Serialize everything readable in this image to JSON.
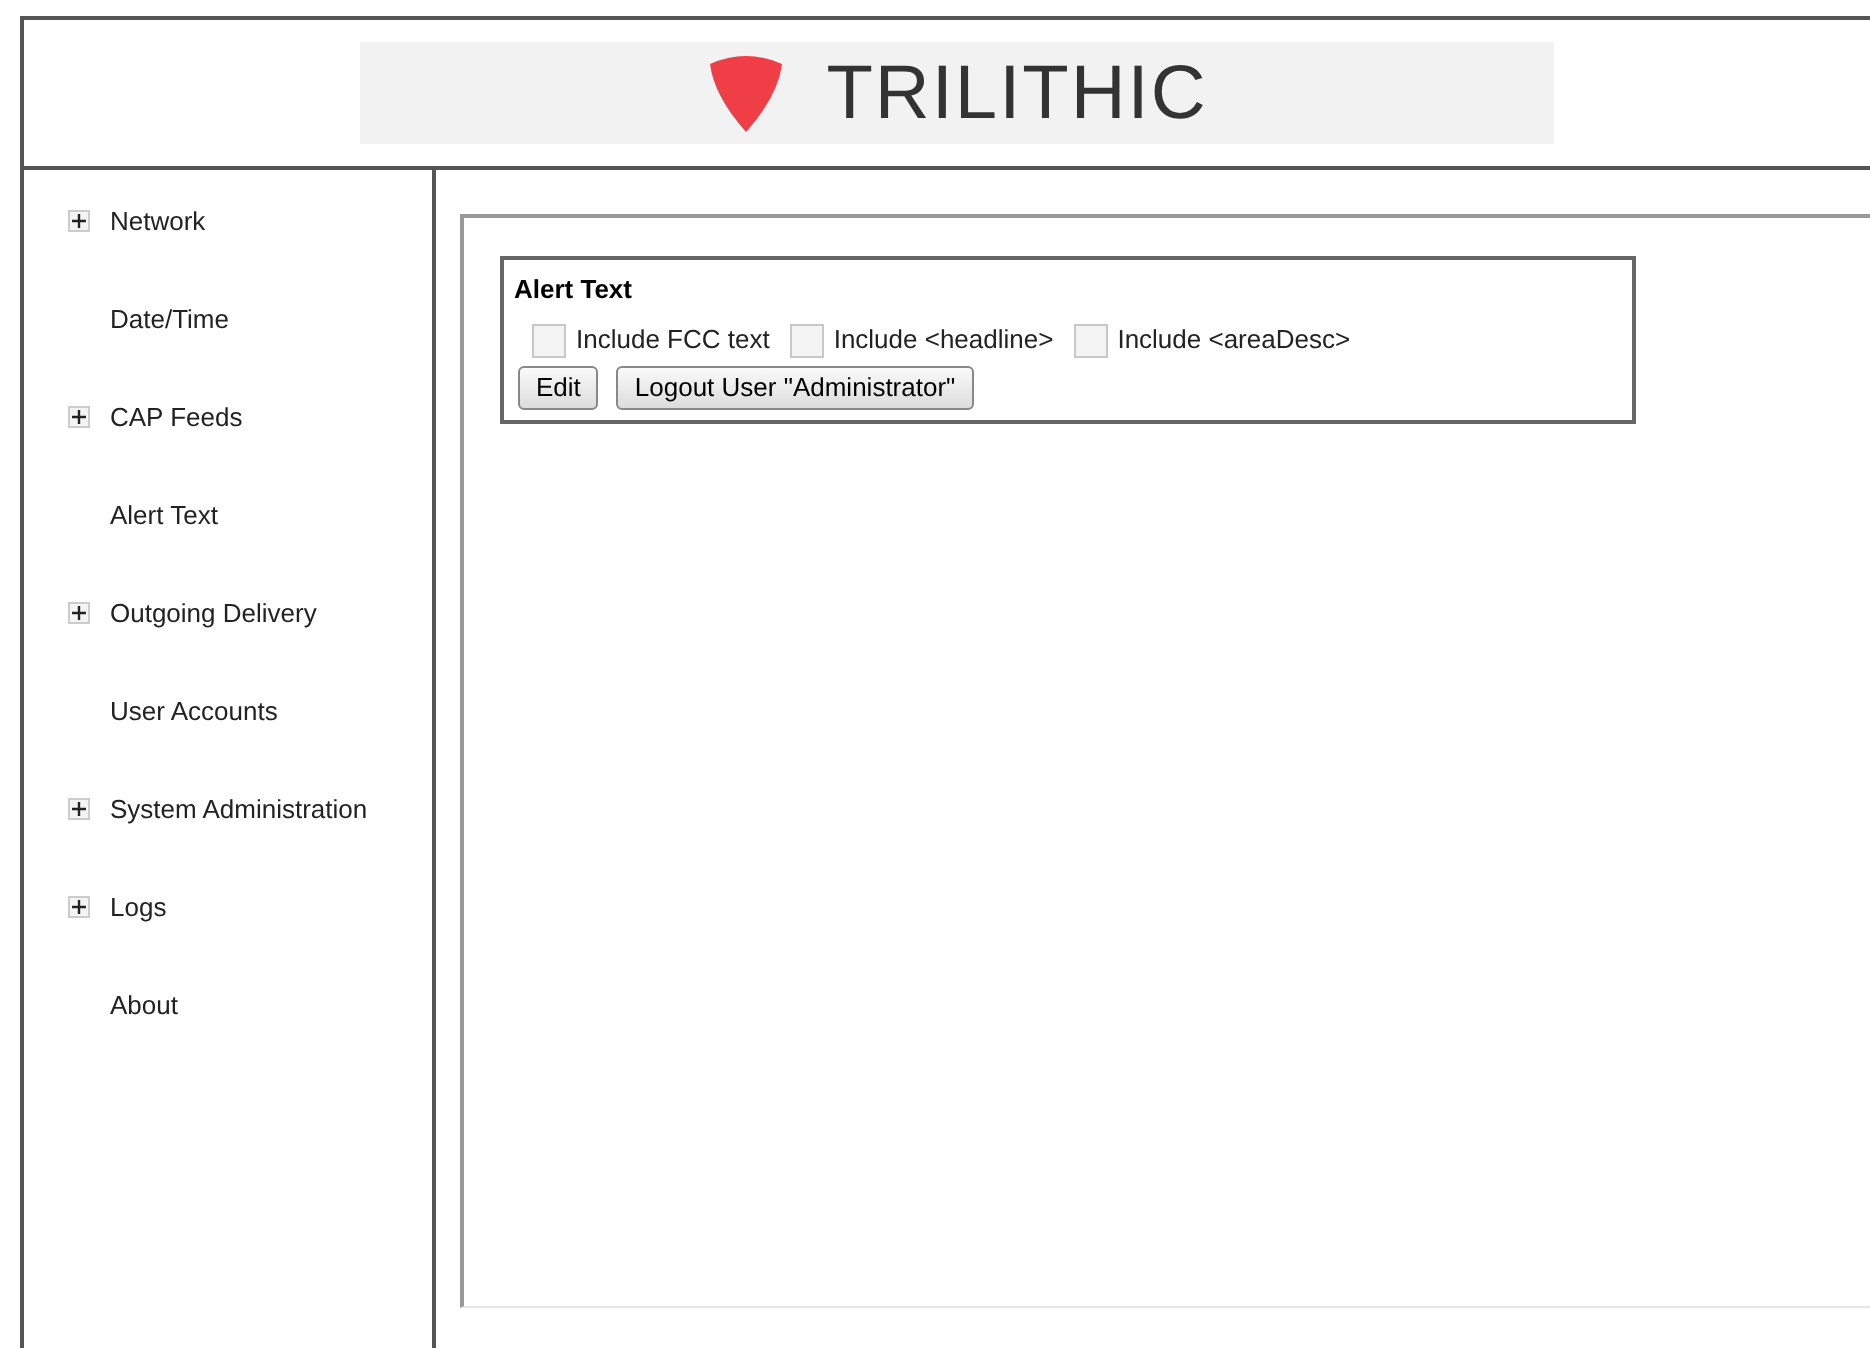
{
  "header": {
    "logo_text": "TRILITHIC"
  },
  "sidebar": {
    "items": [
      {
        "label": "Network",
        "expandable": true
      },
      {
        "label": "Date/Time",
        "expandable": false
      },
      {
        "label": "CAP Feeds",
        "expandable": true
      },
      {
        "label": "Alert Text",
        "expandable": false
      },
      {
        "label": "Outgoing Delivery",
        "expandable": true
      },
      {
        "label": "User Accounts",
        "expandable": false
      },
      {
        "label": "System Administration",
        "expandable": true
      },
      {
        "label": "Logs",
        "expandable": true
      },
      {
        "label": "About",
        "expandable": false
      }
    ]
  },
  "panel": {
    "title": "Alert Text",
    "options": [
      {
        "label": "Include FCC text",
        "checked": false,
        "disabled": true
      },
      {
        "label": "Include <headline>",
        "checked": false,
        "disabled": true
      },
      {
        "label": "Include <areaDesc>",
        "checked": false,
        "disabled": true
      }
    ],
    "buttons": [
      "Edit",
      "Logout User \"Administrator\""
    ]
  }
}
